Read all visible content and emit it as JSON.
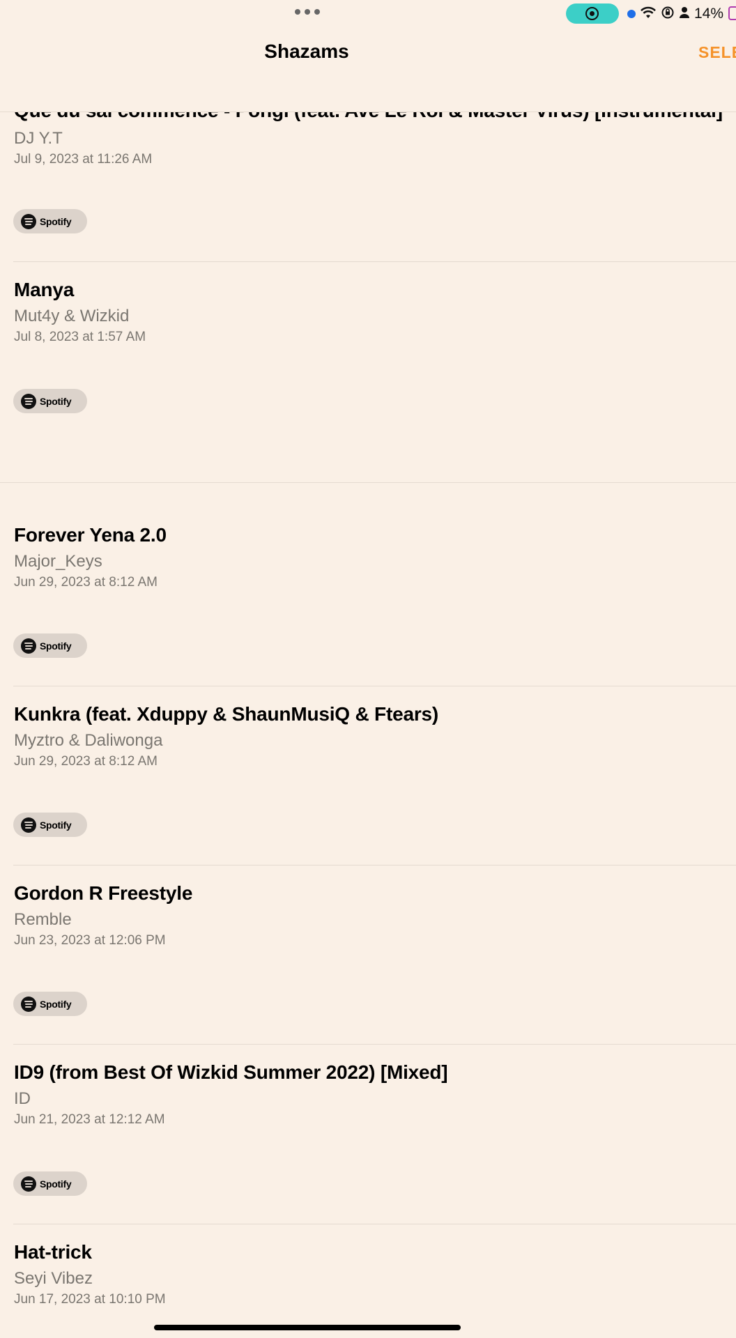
{
  "status_bar": {
    "battery_percent": "14%",
    "icons": [
      "wifi-icon",
      "lock-rotation-icon",
      "person-icon",
      "battery-icon"
    ]
  },
  "nav": {
    "title": "Shazams",
    "select_label": "SELE"
  },
  "items": [
    {
      "title": "Que du sal commence - Pongi (feat. Ave Le Roi & Master Virus) [Instrumental]",
      "artist": "DJ Y.T",
      "date": "Jul 9, 2023 at 11:26 AM",
      "service": "Spotify"
    },
    {
      "title": "Manya",
      "artist": "Mut4y & Wizkid",
      "date": "Jul 8, 2023 at 1:57 AM",
      "service": "Spotify"
    },
    {
      "title": "Forever Yena 2.0",
      "artist": "Major_Keys",
      "date": "Jun 29, 2023 at 8:12 AM",
      "service": "Spotify"
    },
    {
      "title": "Kunkra (feat. Xduppy & ShaunMusiQ & Ftears)",
      "artist": "Myztro & Daliwonga",
      "date": "Jun 29, 2023 at 8:12 AM",
      "service": "Spotify"
    },
    {
      "title": "Gordon R Freestyle",
      "artist": "Remble",
      "date": "Jun 23, 2023 at 12:06 PM",
      "service": "Spotify"
    },
    {
      "title": "ID9 (from Best Of Wizkid Summer 2022) [Mixed]",
      "artist": "ID",
      "date": "Jun 21, 2023 at 12:12 AM",
      "service": "Spotify"
    },
    {
      "title": "Hat-trick",
      "artist": "Seyi Vibez",
      "date": "Jun 17, 2023 at 10:10 PM",
      "service": "Spotify"
    }
  ]
}
